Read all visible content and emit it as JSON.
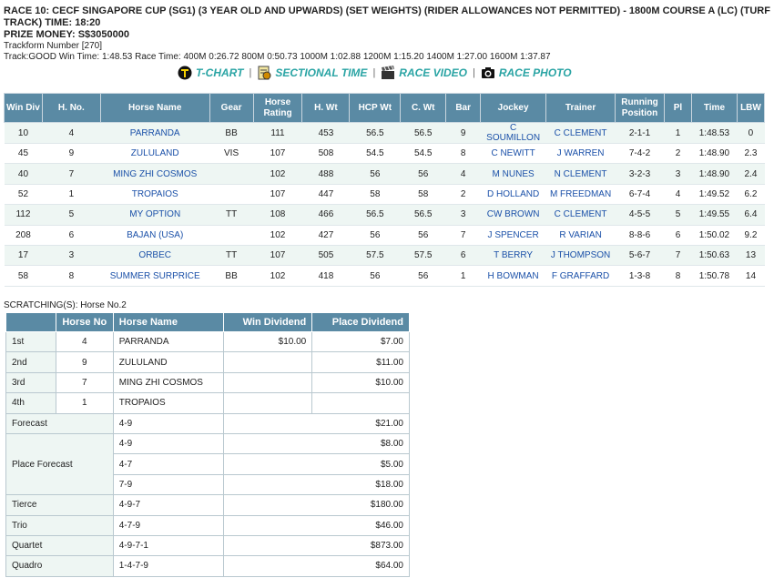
{
  "header": {
    "title": "RACE 10: CECF SINGAPORE CUP (SG1) (3 YEAR OLD AND UPWARDS) (SET WEIGHTS) (RIDER ALLOWANCES NOT PERMITTED) - 1800M COURSE A (LC) (TURF TRACK) TIME: 18:20",
    "prize": "PRIZE MONEY: S$3050000",
    "trackform": "Trackform Number [270]",
    "track_info": "Track:GOOD Win Time: 1:48.53 Race Time: 400M 0:26.72  800M 0:50.73  1000M 1:02.88  1200M 1:15.20  1400M 1:27.00  1600M 1:37.87"
  },
  "links": [
    {
      "icon": "t-chart-icon",
      "label": "T-CHART"
    },
    {
      "icon": "sectional-time-icon",
      "label": "SECTIONAL TIME"
    },
    {
      "icon": "clapperboard-icon",
      "label": "RACE VIDEO"
    },
    {
      "icon": "camera-icon",
      "label": "RACE PHOTO"
    }
  ],
  "results": {
    "headers": [
      "Win Div",
      "H. No.",
      "Horse Name",
      "Gear",
      "Horse Rating",
      "H. Wt",
      "HCP Wt",
      "C. Wt",
      "Bar",
      "Jockey",
      "Trainer",
      "Running Position",
      "Pl",
      "Time",
      "LBW"
    ],
    "rows": [
      [
        "10",
        "4",
        "PARRANDA",
        "BB",
        "111",
        "453",
        "56.5",
        "56.5",
        "9",
        "C SOUMILLON",
        "C CLEMENT",
        "2-1-1",
        "1",
        "1:48.53",
        "0"
      ],
      [
        "45",
        "9",
        "ZULULAND",
        "VIS",
        "107",
        "508",
        "54.5",
        "54.5",
        "8",
        "C NEWITT",
        "J WARREN",
        "7-4-2",
        "2",
        "1:48.90",
        "2.3"
      ],
      [
        "40",
        "7",
        "MING ZHI COSMOS",
        "",
        "102",
        "488",
        "56",
        "56",
        "4",
        "M NUNES",
        "N CLEMENT",
        "3-2-3",
        "3",
        "1:48.90",
        "2.4"
      ],
      [
        "52",
        "1",
        "TROPAIOS",
        "",
        "107",
        "447",
        "58",
        "58",
        "2",
        "D HOLLAND",
        "M FREEDMAN",
        "6-7-4",
        "4",
        "1:49.52",
        "6.2"
      ],
      [
        "112",
        "5",
        "MY OPTION",
        "TT",
        "108",
        "466",
        "56.5",
        "56.5",
        "3",
        "CW BROWN",
        "C CLEMENT",
        "4-5-5",
        "5",
        "1:49.55",
        "6.4"
      ],
      [
        "208",
        "6",
        "BAJAN (USA)",
        "",
        "102",
        "427",
        "56",
        "56",
        "7",
        "J SPENCER",
        "R VARIAN",
        "8-8-6",
        "6",
        "1:50.02",
        "9.2"
      ],
      [
        "17",
        "3",
        "ORBEC",
        "TT",
        "107",
        "505",
        "57.5",
        "57.5",
        "6",
        "T BERRY",
        "J THOMPSON",
        "5-6-7",
        "7",
        "1:50.63",
        "13"
      ],
      [
        "58",
        "8",
        "SUMMER SURPRICE",
        "BB",
        "102",
        "418",
        "56",
        "56",
        "1",
        "H BOWMAN",
        "F GRAFFARD",
        "1-3-8",
        "8",
        "1:50.78",
        "14"
      ]
    ]
  },
  "scratchings": "SCRATCHING(S): Horse No.2",
  "dividends": {
    "headers": [
      "",
      "Horse No",
      "Horse Name",
      "Win Dividend",
      "Place Dividend"
    ],
    "placings": [
      {
        "pos": "1st",
        "no": "4",
        "name": "PARRANDA",
        "win": "$10.00",
        "place": "$7.00"
      },
      {
        "pos": "2nd",
        "no": "9",
        "name": "ZULULAND",
        "win": "",
        "place": "$11.00"
      },
      {
        "pos": "3rd",
        "no": "7",
        "name": "MING ZHI COSMOS",
        "win": "",
        "place": "$10.00"
      },
      {
        "pos": "4th",
        "no": "1",
        "name": "TROPAIOS",
        "win": "",
        "place": ""
      }
    ],
    "forecast": {
      "label": "Forecast",
      "combo": "4-9",
      "amount": "$21.00"
    },
    "place_forecast": {
      "label": "Place Forecast",
      "items": [
        {
          "combo": "4-9",
          "amount": "$8.00"
        },
        {
          "combo": "4-7",
          "amount": "$5.00"
        },
        {
          "combo": "7-9",
          "amount": "$18.00"
        }
      ]
    },
    "others": [
      {
        "label": "Tierce",
        "combo": "4-9-7",
        "amount": "$180.00"
      },
      {
        "label": "Trio",
        "combo": "4-7-9",
        "amount": "$46.00"
      },
      {
        "label": "Quartet",
        "combo": "4-9-7-1",
        "amount": "$873.00"
      },
      {
        "label": "Quadro",
        "combo": "1-4-7-9",
        "amount": "$64.00"
      }
    ]
  }
}
